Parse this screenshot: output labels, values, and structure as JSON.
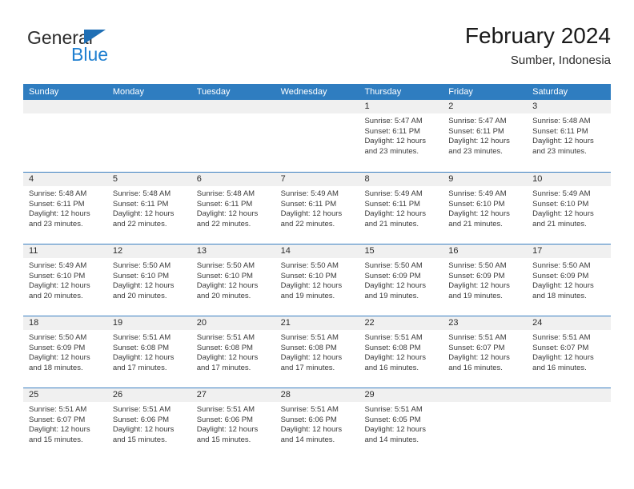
{
  "brand": {
    "word_top": "General",
    "word_bottom": "Blue",
    "accent_color": "#1f7fd0",
    "triangle_color": "#1f6fb5"
  },
  "header": {
    "title": "February 2024",
    "subtitle": "Sumber, Indonesia"
  },
  "theme": {
    "header_blue": "#2f7dc0",
    "daynum_band": "#f0f0f0",
    "row_divider": "#3a7fc1",
    "text": "#3a3a3a"
  },
  "weekdays": [
    "Sunday",
    "Monday",
    "Tuesday",
    "Wednesday",
    "Thursday",
    "Friday",
    "Saturday"
  ],
  "weeks": [
    [
      {
        "day": "",
        "lines": []
      },
      {
        "day": "",
        "lines": []
      },
      {
        "day": "",
        "lines": []
      },
      {
        "day": "",
        "lines": []
      },
      {
        "day": "1",
        "lines": [
          "Sunrise: 5:47 AM",
          "Sunset: 6:11 PM",
          "Daylight: 12 hours",
          "and 23 minutes."
        ]
      },
      {
        "day": "2",
        "lines": [
          "Sunrise: 5:47 AM",
          "Sunset: 6:11 PM",
          "Daylight: 12 hours",
          "and 23 minutes."
        ]
      },
      {
        "day": "3",
        "lines": [
          "Sunrise: 5:48 AM",
          "Sunset: 6:11 PM",
          "Daylight: 12 hours",
          "and 23 minutes."
        ]
      }
    ],
    [
      {
        "day": "4",
        "lines": [
          "Sunrise: 5:48 AM",
          "Sunset: 6:11 PM",
          "Daylight: 12 hours",
          "and 23 minutes."
        ]
      },
      {
        "day": "5",
        "lines": [
          "Sunrise: 5:48 AM",
          "Sunset: 6:11 PM",
          "Daylight: 12 hours",
          "and 22 minutes."
        ]
      },
      {
        "day": "6",
        "lines": [
          "Sunrise: 5:48 AM",
          "Sunset: 6:11 PM",
          "Daylight: 12 hours",
          "and 22 minutes."
        ]
      },
      {
        "day": "7",
        "lines": [
          "Sunrise: 5:49 AM",
          "Sunset: 6:11 PM",
          "Daylight: 12 hours",
          "and 22 minutes."
        ]
      },
      {
        "day": "8",
        "lines": [
          "Sunrise: 5:49 AM",
          "Sunset: 6:11 PM",
          "Daylight: 12 hours",
          "and 21 minutes."
        ]
      },
      {
        "day": "9",
        "lines": [
          "Sunrise: 5:49 AM",
          "Sunset: 6:10 PM",
          "Daylight: 12 hours",
          "and 21 minutes."
        ]
      },
      {
        "day": "10",
        "lines": [
          "Sunrise: 5:49 AM",
          "Sunset: 6:10 PM",
          "Daylight: 12 hours",
          "and 21 minutes."
        ]
      }
    ],
    [
      {
        "day": "11",
        "lines": [
          "Sunrise: 5:49 AM",
          "Sunset: 6:10 PM",
          "Daylight: 12 hours",
          "and 20 minutes."
        ]
      },
      {
        "day": "12",
        "lines": [
          "Sunrise: 5:50 AM",
          "Sunset: 6:10 PM",
          "Daylight: 12 hours",
          "and 20 minutes."
        ]
      },
      {
        "day": "13",
        "lines": [
          "Sunrise: 5:50 AM",
          "Sunset: 6:10 PM",
          "Daylight: 12 hours",
          "and 20 minutes."
        ]
      },
      {
        "day": "14",
        "lines": [
          "Sunrise: 5:50 AM",
          "Sunset: 6:10 PM",
          "Daylight: 12 hours",
          "and 19 minutes."
        ]
      },
      {
        "day": "15",
        "lines": [
          "Sunrise: 5:50 AM",
          "Sunset: 6:09 PM",
          "Daylight: 12 hours",
          "and 19 minutes."
        ]
      },
      {
        "day": "16",
        "lines": [
          "Sunrise: 5:50 AM",
          "Sunset: 6:09 PM",
          "Daylight: 12 hours",
          "and 19 minutes."
        ]
      },
      {
        "day": "17",
        "lines": [
          "Sunrise: 5:50 AM",
          "Sunset: 6:09 PM",
          "Daylight: 12 hours",
          "and 18 minutes."
        ]
      }
    ],
    [
      {
        "day": "18",
        "lines": [
          "Sunrise: 5:50 AM",
          "Sunset: 6:09 PM",
          "Daylight: 12 hours",
          "and 18 minutes."
        ]
      },
      {
        "day": "19",
        "lines": [
          "Sunrise: 5:51 AM",
          "Sunset: 6:08 PM",
          "Daylight: 12 hours",
          "and 17 minutes."
        ]
      },
      {
        "day": "20",
        "lines": [
          "Sunrise: 5:51 AM",
          "Sunset: 6:08 PM",
          "Daylight: 12 hours",
          "and 17 minutes."
        ]
      },
      {
        "day": "21",
        "lines": [
          "Sunrise: 5:51 AM",
          "Sunset: 6:08 PM",
          "Daylight: 12 hours",
          "and 17 minutes."
        ]
      },
      {
        "day": "22",
        "lines": [
          "Sunrise: 5:51 AM",
          "Sunset: 6:08 PM",
          "Daylight: 12 hours",
          "and 16 minutes."
        ]
      },
      {
        "day": "23",
        "lines": [
          "Sunrise: 5:51 AM",
          "Sunset: 6:07 PM",
          "Daylight: 12 hours",
          "and 16 minutes."
        ]
      },
      {
        "day": "24",
        "lines": [
          "Sunrise: 5:51 AM",
          "Sunset: 6:07 PM",
          "Daylight: 12 hours",
          "and 16 minutes."
        ]
      }
    ],
    [
      {
        "day": "25",
        "lines": [
          "Sunrise: 5:51 AM",
          "Sunset: 6:07 PM",
          "Daylight: 12 hours",
          "and 15 minutes."
        ]
      },
      {
        "day": "26",
        "lines": [
          "Sunrise: 5:51 AM",
          "Sunset: 6:06 PM",
          "Daylight: 12 hours",
          "and 15 minutes."
        ]
      },
      {
        "day": "27",
        "lines": [
          "Sunrise: 5:51 AM",
          "Sunset: 6:06 PM",
          "Daylight: 12 hours",
          "and 15 minutes."
        ]
      },
      {
        "day": "28",
        "lines": [
          "Sunrise: 5:51 AM",
          "Sunset: 6:06 PM",
          "Daylight: 12 hours",
          "and 14 minutes."
        ]
      },
      {
        "day": "29",
        "lines": [
          "Sunrise: 5:51 AM",
          "Sunset: 6:05 PM",
          "Daylight: 12 hours",
          "and 14 minutes."
        ]
      },
      {
        "day": "",
        "lines": []
      },
      {
        "day": "",
        "lines": []
      }
    ]
  ]
}
